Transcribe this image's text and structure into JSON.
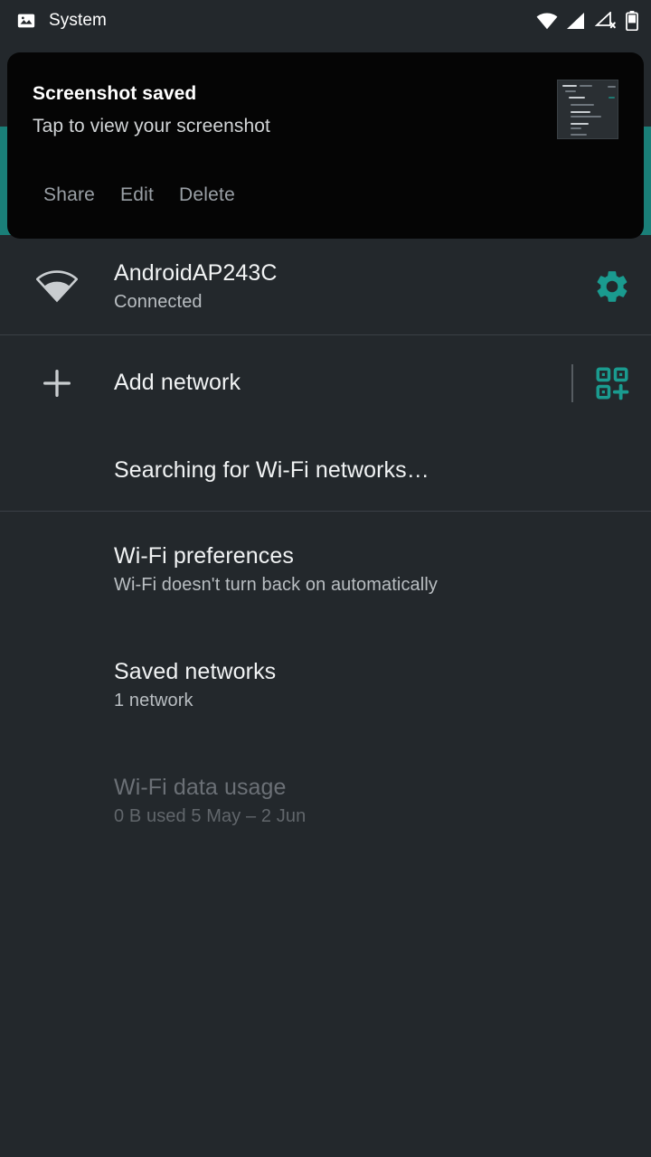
{
  "statusbar": {
    "app_label": "System",
    "icons": {
      "notification": "image-icon",
      "wifi": "wifi-signal-icon",
      "cellular1": "cellular-signal-icon",
      "cellular2": "cellular-no-sim-icon",
      "battery": "battery-icon"
    }
  },
  "notification": {
    "title": "Screenshot saved",
    "body": "Tap to view your screenshot",
    "actions": [
      "Share",
      "Edit",
      "Delete"
    ],
    "thumbnail_name": "screenshot-thumbnail",
    "background": "#050505"
  },
  "colors": {
    "accent_teal": "#1a9b8f",
    "background": "#23282c",
    "teal_strip": "#1a7f78"
  },
  "wifi_list": [
    {
      "id": "connected-network",
      "title": "AndroidAP243C",
      "subtitle": "Connected",
      "leading_icon": "wifi-signal-icon",
      "trailing_icon": "gear-icon",
      "dim": false
    },
    {
      "id": "add-network",
      "title": "Add network",
      "subtitle": "",
      "leading_icon": "plus-icon",
      "trailing_icon": "qr-scan-icon",
      "dim": false
    },
    {
      "id": "searching",
      "title": "Searching for Wi-Fi networks…",
      "subtitle": "",
      "leading_icon": "",
      "trailing_icon": "",
      "dim": false
    },
    {
      "id": "wifi-preferences",
      "title": "Wi-Fi preferences",
      "subtitle": "Wi-Fi doesn't turn back on automatically",
      "leading_icon": "",
      "trailing_icon": "",
      "dim": false
    },
    {
      "id": "saved-networks",
      "title": "Saved networks",
      "subtitle": "1 network",
      "leading_icon": "",
      "trailing_icon": "",
      "dim": false
    },
    {
      "id": "wifi-data-usage",
      "title": "Wi-Fi data usage",
      "subtitle": "0 B used 5 May – 2 Jun",
      "leading_icon": "",
      "trailing_icon": "",
      "dim": true
    }
  ]
}
